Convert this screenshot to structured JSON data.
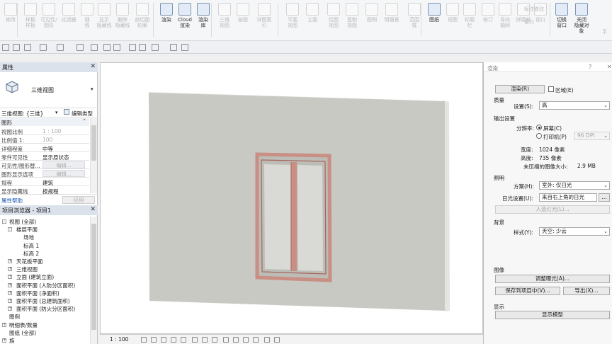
{
  "ribbon": {
    "buttons": [
      {
        "label": "修改",
        "enabled": false
      },
      {
        "label": "样板\n样板",
        "enabled": false
      },
      {
        "label": "可见性/\n图形",
        "enabled": false
      },
      {
        "label": "过滤器",
        "enabled": false
      },
      {
        "label": "细\n线",
        "enabled": false
      },
      {
        "label": "显示\n隐藏线",
        "enabled": false
      },
      {
        "label": "删除\n隐藏线",
        "enabled": false
      },
      {
        "label": "剖切面\n轮廓",
        "enabled": false
      },
      {
        "label": "渲染",
        "enabled": true
      },
      {
        "label": "Cloud\n渲染",
        "enabled": true
      },
      {
        "label": "渲染\n库",
        "enabled": true
      },
      {
        "label": "三维\n视图",
        "enabled": false
      },
      {
        "label": "剖面",
        "enabled": false
      },
      {
        "label": "详图索引",
        "enabled": false
      },
      {
        "label": "平面\n视图",
        "enabled": false
      },
      {
        "label": "立面",
        "enabled": false
      },
      {
        "label": "绘图\n视图",
        "enabled": false
      },
      {
        "label": "复制\n视图",
        "enabled": false
      },
      {
        "label": "图例",
        "enabled": false
      },
      {
        "label": "明细表",
        "enabled": false
      },
      {
        "label": "范围\n框",
        "enabled": false
      },
      {
        "label": "图纸",
        "enabled": true
      },
      {
        "label": "视图",
        "enabled": false
      },
      {
        "label": "标题\n栏",
        "enabled": false
      },
      {
        "label": "修订",
        "enabled": false
      },
      {
        "label": "导向\n轴网",
        "enabled": false
      },
      {
        "label": "拼接线",
        "enabled": false
      },
      {
        "label": "视口",
        "enabled": false
      },
      {
        "label": "切换\n窗口",
        "enabled": true
      },
      {
        "label": "关闭\n隐藏对象",
        "enabled": true
      }
    ],
    "small_items": [
      "标注修改",
      "窗口",
      "平"
    ]
  },
  "properties": {
    "title": "属性",
    "type_name": "三维视图",
    "selector": "三维视图: {三维}",
    "edit_type": "编辑类型",
    "category": "图形",
    "rows": [
      {
        "k": "视图比例",
        "v": "1 : 100",
        "dim": true
      },
      {
        "k": "比例值 1:",
        "v": "100",
        "dim": true
      },
      {
        "k": "详细程度",
        "v": "中等",
        "dim": false
      },
      {
        "k": "零件可见性",
        "v": "显示原状态",
        "dim": false
      },
      {
        "k": "可见性/图形替...",
        "btn": "编辑..."
      },
      {
        "k": "图形显示选项",
        "btn": "编辑..."
      },
      {
        "k": "规程",
        "v": "建筑",
        "dim": false
      },
      {
        "k": "显示隐藏线",
        "v": "按规程",
        "dim": false
      }
    ],
    "help": "属性帮助",
    "apply": "应用"
  },
  "browser": {
    "title": "项目浏览器 - 项目1",
    "items": [
      {
        "label": "视图 (全部)",
        "level": 0,
        "toggle": "-"
      },
      {
        "label": "楼层平面",
        "level": 1,
        "toggle": "-"
      },
      {
        "label": "场地",
        "level": 2,
        "toggle": ""
      },
      {
        "label": "标高 1",
        "level": 2,
        "toggle": ""
      },
      {
        "label": "标高 2",
        "level": 2,
        "toggle": ""
      },
      {
        "label": "天花板平面",
        "level": 1,
        "toggle": "+"
      },
      {
        "label": "三维视图",
        "level": 1,
        "toggle": "+"
      },
      {
        "label": "立面 (建筑立面)",
        "level": 1,
        "toggle": "+"
      },
      {
        "label": "面积平面 (人防分区面积)",
        "level": 1,
        "toggle": "+"
      },
      {
        "label": "面积平面 (净面积)",
        "level": 1,
        "toggle": "+"
      },
      {
        "label": "面积平面 (总建筑面积)",
        "level": 1,
        "toggle": "+"
      },
      {
        "label": "面积平面 (防火分区面积)",
        "level": 1,
        "toggle": "+"
      },
      {
        "label": "图例",
        "level": 0,
        "toggle": ""
      },
      {
        "label": "明细表/数量",
        "level": 0,
        "toggle": "+"
      },
      {
        "label": "图纸 (全部)",
        "level": 0,
        "toggle": ""
      },
      {
        "label": "族",
        "level": 0,
        "toggle": "+"
      }
    ]
  },
  "statusbar": {
    "scale": "1 : 100"
  },
  "render_dialog": {
    "title": "渲染",
    "help": "?",
    "render_button": "渲染(R)",
    "region_label": "区域(E)",
    "quality": {
      "heading": "质量",
      "setting_label": "设置(S):",
      "setting_value": "高"
    },
    "output": {
      "heading": "输出设置",
      "resolution_label": "分辨率:",
      "screen": "屏幕(C)",
      "printer": "打印机(P)",
      "dpi": "96 DPI",
      "width_label": "宽度:",
      "width_value": "1024 像素",
      "height_label": "高度:",
      "height_value": "735 像素",
      "size_label": "未压缩的图像大小:",
      "size_value": "2.9 MB"
    },
    "lighting": {
      "heading": "照明",
      "scheme_label": "方案(H):",
      "scheme_value": "室外: 仅日光",
      "sun_label": "日光设置(U):",
      "sun_value": "来自右上角的日光",
      "more": "...",
      "artificial": "人造灯光(L)..."
    },
    "background": {
      "heading": "背景",
      "style_label": "样式(Y):",
      "style_value": "天空: 少云"
    },
    "image": {
      "heading": "图像",
      "adjust": "调整曝光(A)...",
      "save": "保存到项目中(V)...",
      "export": "导出(X)..."
    },
    "display": {
      "heading": "显示",
      "show_model": "显示模型"
    }
  },
  "colors": {
    "wall_face": "#c8c9c3",
    "wall_side": "#e4e5e1",
    "frame": "#c98f84",
    "frame_dark": "#a8665c",
    "glass": "#d9dad5"
  }
}
